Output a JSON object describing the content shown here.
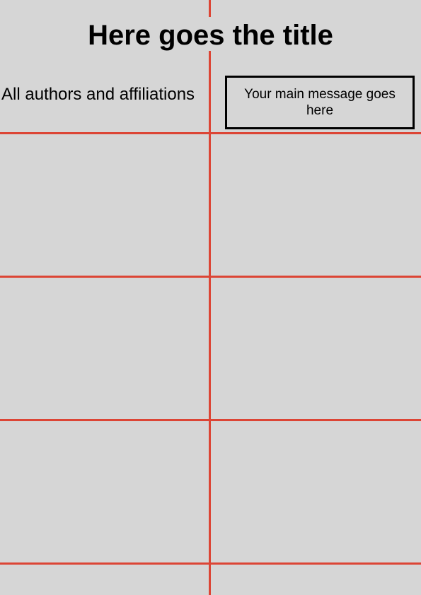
{
  "poster": {
    "title": "Here goes the title",
    "authors": "All authors and affiliations",
    "main_message": "Your main message goes here"
  },
  "colors": {
    "background": "#d6d6d6",
    "grid_lines": "#dc4535",
    "text": "#000000"
  }
}
